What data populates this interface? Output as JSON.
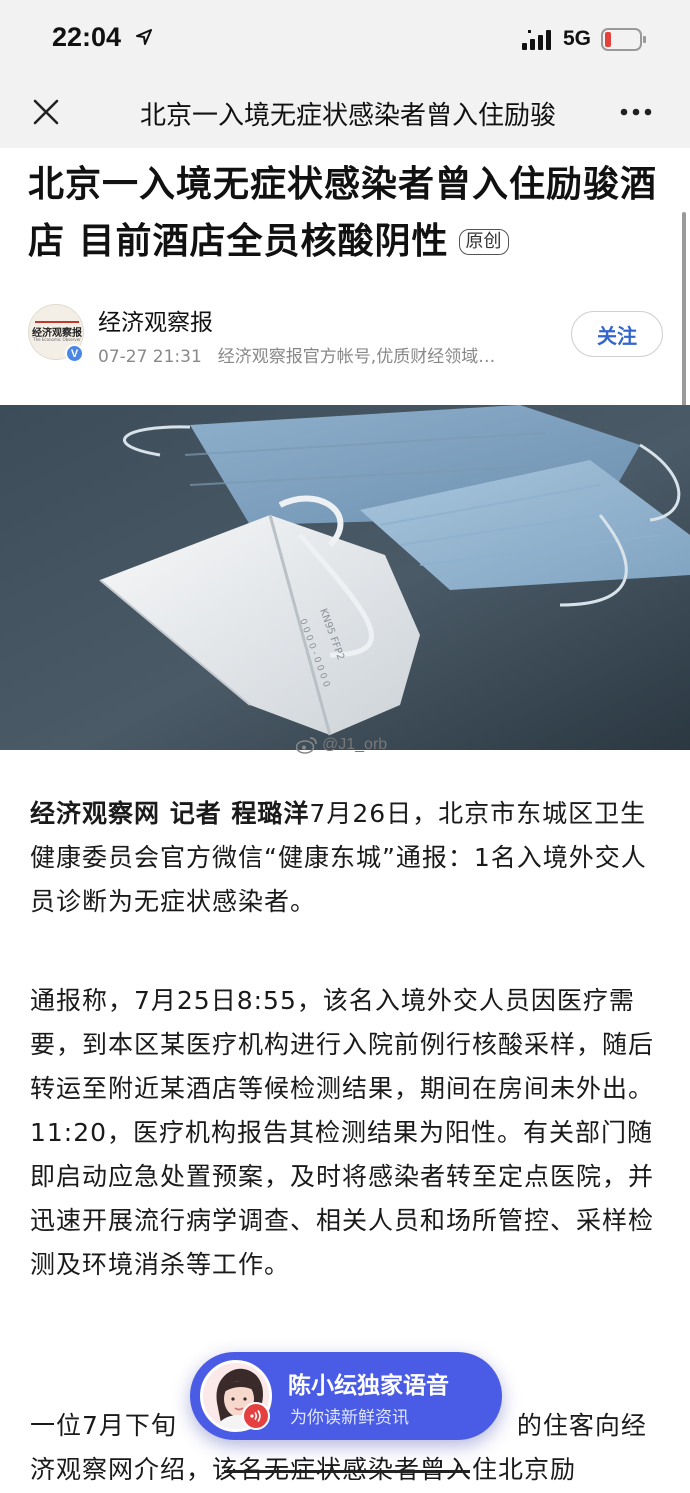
{
  "status_bar": {
    "time": "22:04",
    "network": "5G",
    "icons": [
      "location-arrow-icon",
      "signal-icon",
      "battery-low-icon"
    ],
    "battery_color": "#e5413c"
  },
  "nav": {
    "title": "北京一入境无症状感染者曾入住励骏",
    "close_icon": "close-icon",
    "more_icon": "more-icon"
  },
  "article": {
    "title": "北京一入境无症状感染者曾入住励骏酒店 目前酒店全员核酸阴性",
    "badge": "原创",
    "author": {
      "name": "经济观察报",
      "avatar_text": "经济观察报",
      "avatar_sub": "The Economic Observer",
      "verified_mark": "V",
      "date": "07-27 21:31",
      "description": "经济观察报官方帐号,优质财经领域…",
      "follow_label": "关注"
    },
    "image_watermark": "@J1_orb",
    "paragraphs": {
      "p1_lead": "经济观察网 记者 程璐洋",
      "p1_text": "7月26日，北京市东城区卫生健康委员会官方微信“健康东城”通报：1名入境外交人员诊断为无症状感染者。",
      "p2_text": "通报称，7月25日8:55，该名入境外交人员因医疗需要，到本区某医疗机构进行入院前例行核酸采样，随后转运至附近某酒店等候检测结果，期间在房间未外出。11:20，医疗机构报告其检测结果为阳性。有关部门随即启动应急处置预案，及时将感染者转至定点医院，并迅速开展流行病学调查、相关人员和场所管控、采样检测及环境消杀等工作。",
      "p3_text": "一位7月下旬                                      的住客向经济观察网介绍，该名无症状感染者曾入住北京励"
    }
  },
  "voice_card": {
    "title": "陈小纭独家语音",
    "subtitle": "为你读新鲜资讯",
    "color": "#4a5ce6"
  },
  "colors": {
    "accent_blue": "#3366cc",
    "verify_blue": "#4a86e8"
  }
}
